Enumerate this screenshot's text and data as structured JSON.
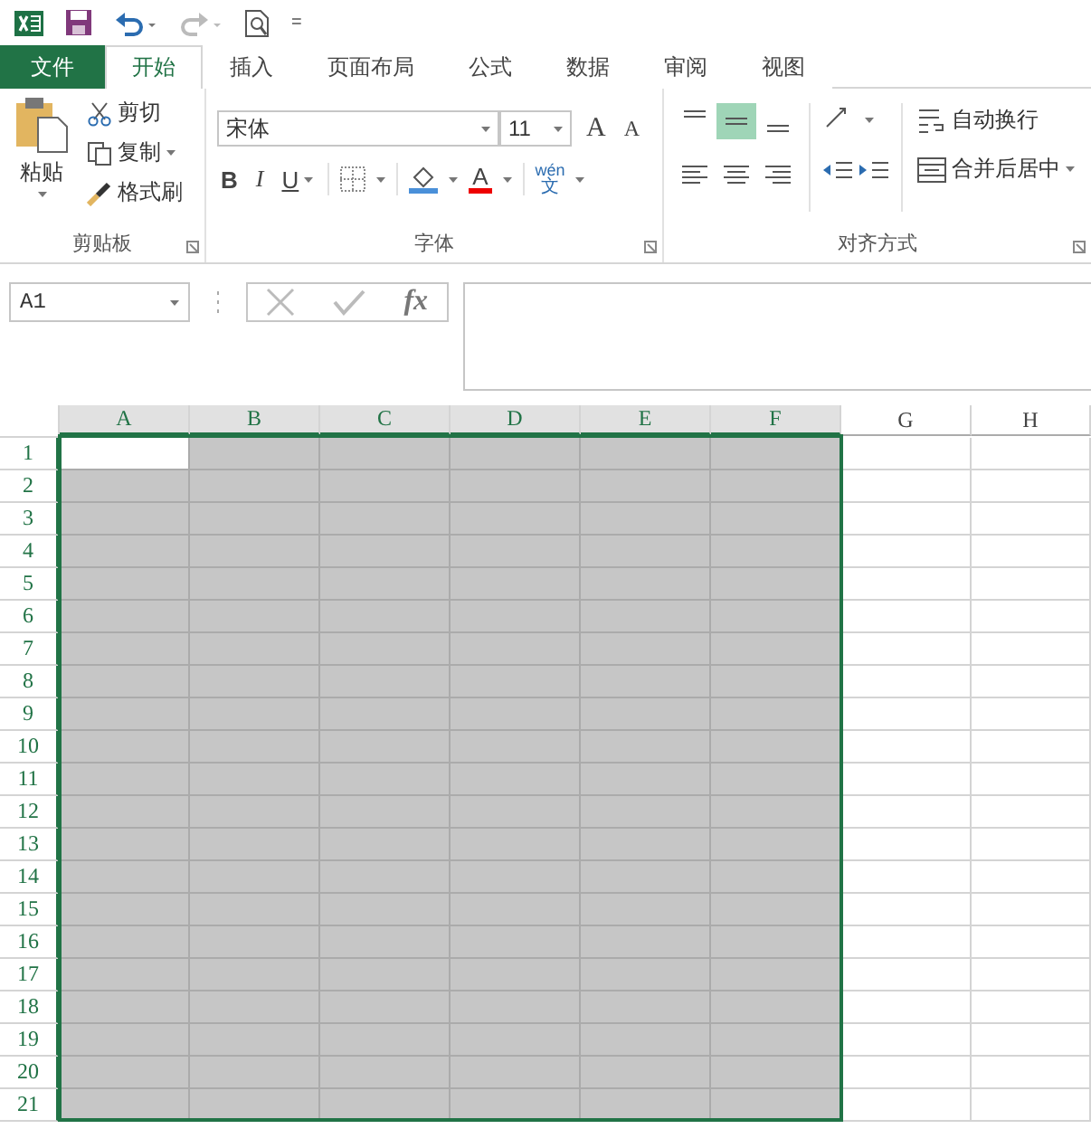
{
  "quick_access": {
    "more": "="
  },
  "tabs": [
    {
      "label": "文件",
      "kind": "file",
      "selected": false
    },
    {
      "label": "开始",
      "kind": "tab",
      "selected": true
    },
    {
      "label": "插入",
      "kind": "tab",
      "selected": false
    },
    {
      "label": "页面布局",
      "kind": "tab",
      "selected": false
    },
    {
      "label": "公式",
      "kind": "tab",
      "selected": false
    },
    {
      "label": "数据",
      "kind": "tab",
      "selected": false
    },
    {
      "label": "审阅",
      "kind": "tab",
      "selected": false
    },
    {
      "label": "视图",
      "kind": "tab",
      "selected": false
    }
  ],
  "clipboard": {
    "paste": "粘贴",
    "cut": "剪切",
    "copy": "复制",
    "format_painter": "格式刷",
    "group_label": "剪贴板"
  },
  "font": {
    "name": "宋体",
    "size": "11",
    "grow": "A",
    "shrink": "A",
    "bold": "B",
    "italic": "I",
    "underline": "U",
    "font_color": "A",
    "phonetic": "wén",
    "phonetic_char": "文",
    "group_label": "字体"
  },
  "alignment": {
    "vertical": [
      {
        "kind": "top",
        "selected": false
      },
      {
        "kind": "middle",
        "selected": true
      },
      {
        "kind": "bottom",
        "selected": false
      }
    ],
    "wrap_text": "自动换行",
    "merge_center": "合并后居中",
    "group_label": "对齐方式"
  },
  "name_box": {
    "value": "A1"
  },
  "formula_bar": {
    "fx": "fx"
  },
  "sheet": {
    "columns": [
      {
        "label": "A",
        "selected": true
      },
      {
        "label": "B",
        "selected": true
      },
      {
        "label": "C",
        "selected": true
      },
      {
        "label": "D",
        "selected": true
      },
      {
        "label": "E",
        "selected": true
      },
      {
        "label": "F",
        "selected": true
      },
      {
        "label": "G",
        "selected": false
      },
      {
        "label": "H",
        "selected": false
      }
    ],
    "rows": [
      {
        "label": "1",
        "selected": true
      },
      {
        "label": "2",
        "selected": true
      },
      {
        "label": "3",
        "selected": true
      },
      {
        "label": "4",
        "selected": true
      },
      {
        "label": "5",
        "selected": true
      },
      {
        "label": "6",
        "selected": true
      },
      {
        "label": "7",
        "selected": true
      },
      {
        "label": "8",
        "selected": true
      },
      {
        "label": "9",
        "selected": true
      },
      {
        "label": "10",
        "selected": true
      },
      {
        "label": "11",
        "selected": true
      },
      {
        "label": "12",
        "selected": true
      },
      {
        "label": "13",
        "selected": true
      },
      {
        "label": "14",
        "selected": true
      },
      {
        "label": "15",
        "selected": true
      },
      {
        "label": "16",
        "selected": true
      },
      {
        "label": "17",
        "selected": true
      },
      {
        "label": "18",
        "selected": true
      },
      {
        "label": "19",
        "selected": true
      },
      {
        "label": "20",
        "selected": true
      },
      {
        "label": "21",
        "selected": true
      }
    ]
  }
}
